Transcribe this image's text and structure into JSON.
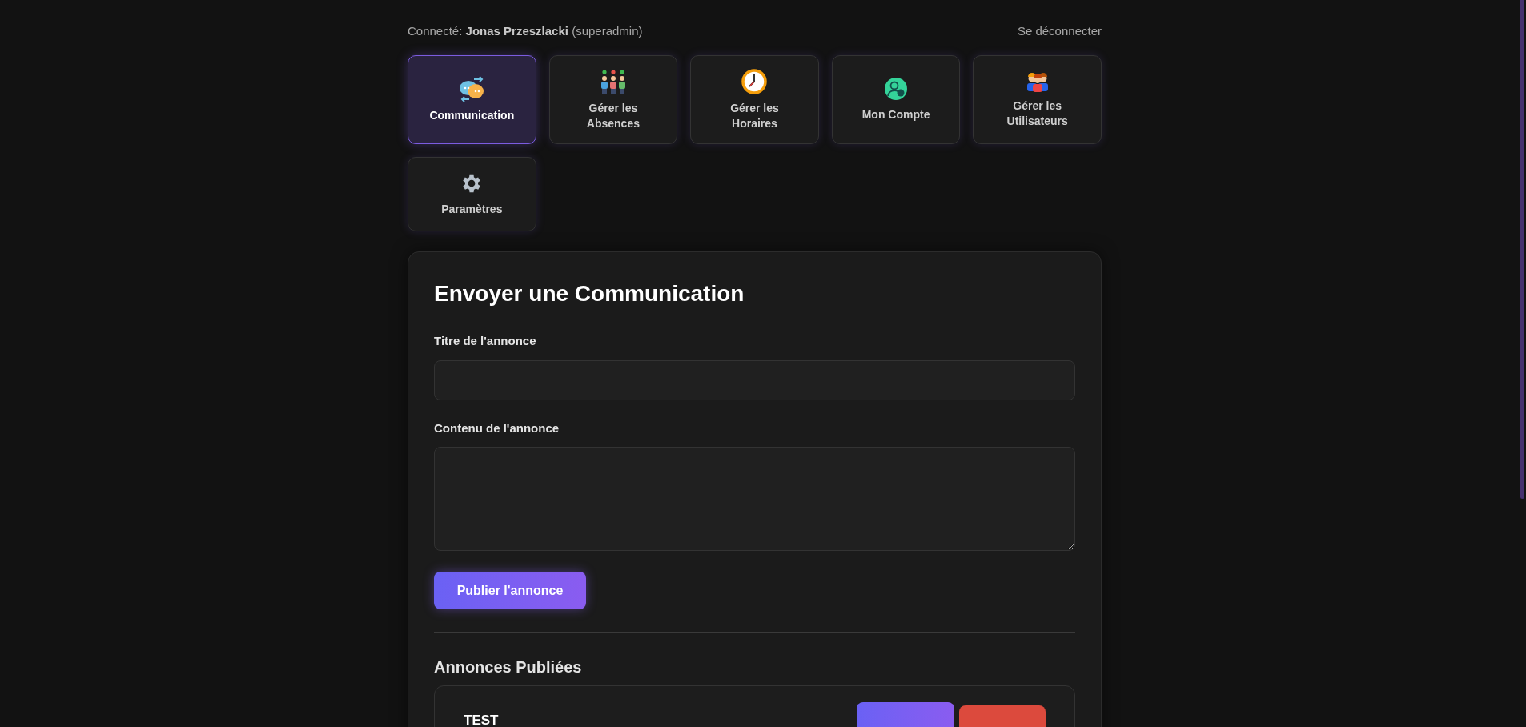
{
  "header": {
    "connected_label": "Connecté:",
    "user_name": "Jonas Przeszlacki",
    "role": "(superadmin)",
    "logout": "Se déconnecter"
  },
  "nav": [
    {
      "label": "Communication",
      "kind": "chat",
      "selected": true
    },
    {
      "label": "Gérer les Absences",
      "kind": "people",
      "selected": false
    },
    {
      "label": "Gérer les Horaires",
      "kind": "clock",
      "selected": false
    },
    {
      "label": "Mon Compte",
      "kind": "account",
      "selected": false
    },
    {
      "label": "Gérer les Utilisateurs",
      "kind": "users",
      "selected": false
    },
    {
      "label": "Paramètres",
      "kind": "gear",
      "selected": false
    }
  ],
  "form": {
    "title": "Envoyer une Communication",
    "title_label": "Titre de l'annonce",
    "content_label": "Contenu de l'annonce",
    "submit": "Publier l'annonce"
  },
  "published": {
    "heading": "Annonces Publiées",
    "items": [
      {
        "title": "TEST"
      }
    ]
  }
}
